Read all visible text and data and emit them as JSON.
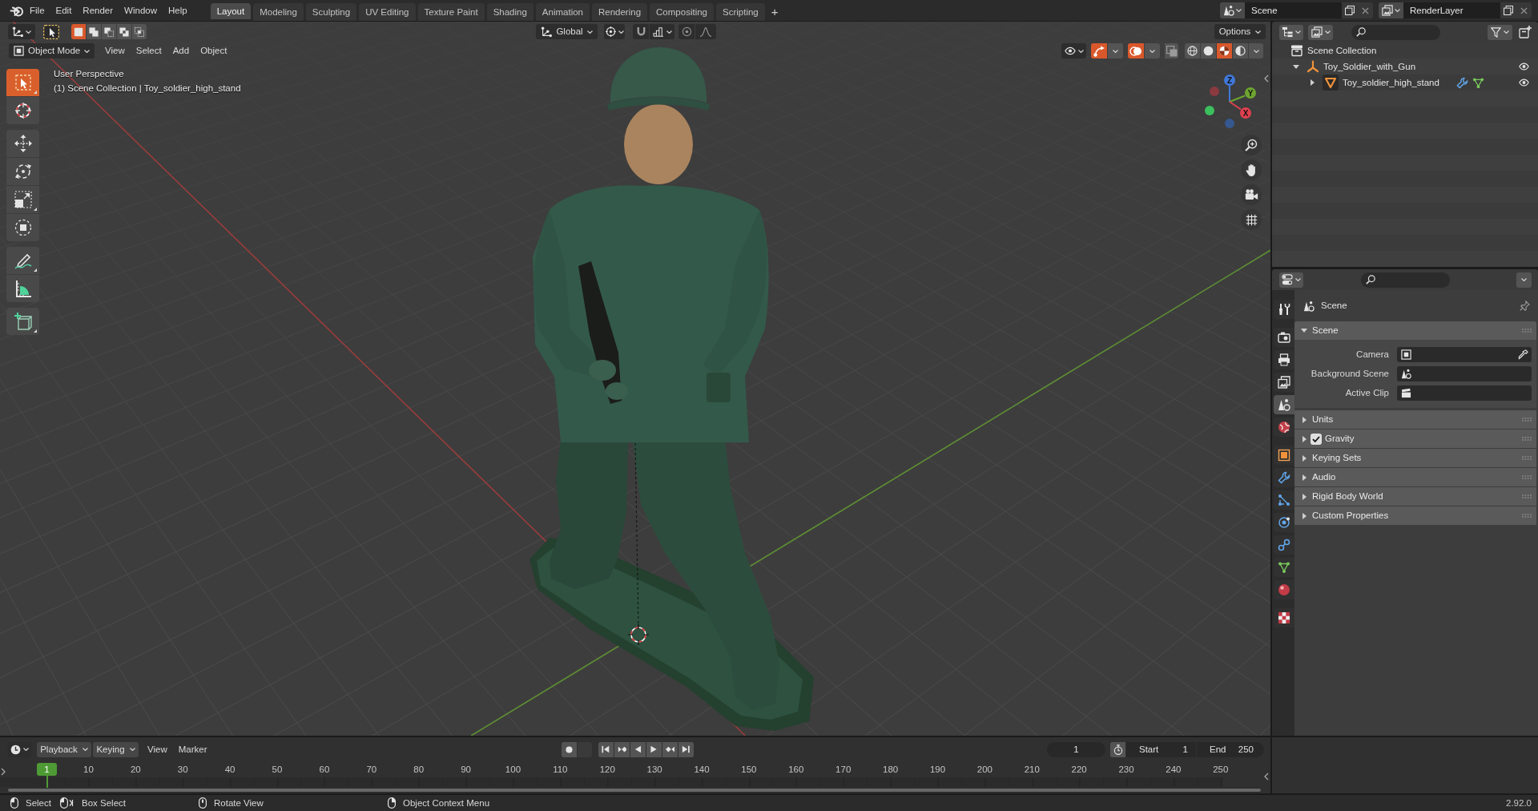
{
  "topbar": {
    "menus": [
      "File",
      "Edit",
      "Render",
      "Window",
      "Help"
    ],
    "workspaces": [
      {
        "label": "Layout",
        "selected": true
      },
      {
        "label": "Modeling",
        "selected": false
      },
      {
        "label": "Sculpting",
        "selected": false
      },
      {
        "label": "UV Editing",
        "selected": false
      },
      {
        "label": "Texture Paint",
        "selected": false
      },
      {
        "label": "Shading",
        "selected": false
      },
      {
        "label": "Animation",
        "selected": false
      },
      {
        "label": "Rendering",
        "selected": false
      },
      {
        "label": "Compositing",
        "selected": false
      },
      {
        "label": "Scripting",
        "selected": false
      }
    ],
    "add_workspace": "+",
    "scene": "Scene",
    "view_layer": "RenderLayer"
  },
  "viewport": {
    "editor_header": {
      "selection_modes": [
        {
          "kind": "set",
          "selected": true
        },
        {
          "kind": "extend",
          "selected": false
        },
        {
          "kind": "subtract",
          "selected": false
        },
        {
          "kind": "difference",
          "selected": false
        },
        {
          "kind": "intersect",
          "selected": false
        }
      ],
      "transform_orientation": "Global",
      "options": "Options"
    },
    "mode": "Object Mode",
    "menus": [
      "View",
      "Select",
      "Add",
      "Object"
    ],
    "toggles": [
      {
        "kind": "gizmos",
        "on": true
      },
      {
        "kind": "overlays",
        "on": true
      },
      {
        "kind": "xray",
        "on": false
      }
    ],
    "shading": [
      {
        "kind": "wireframe",
        "selected": false
      },
      {
        "kind": "solid",
        "selected": false
      },
      {
        "kind": "material",
        "selected": true
      },
      {
        "kind": "rendered",
        "selected": false
      }
    ],
    "tools": [
      [
        {
          "kind": "select_box",
          "selected": true
        },
        {
          "kind": "cursor",
          "selected": false
        }
      ],
      [
        {
          "kind": "move",
          "selected": false
        },
        {
          "kind": "rotate",
          "selected": false
        },
        {
          "kind": "scale",
          "selected": false
        },
        {
          "kind": "transform",
          "selected": false
        }
      ],
      [
        {
          "kind": "annotate",
          "selected": false
        },
        {
          "kind": "measure",
          "selected": false
        }
      ],
      [
        {
          "kind": "add_cube",
          "selected": false
        }
      ]
    ],
    "info": [
      "User Perspective",
      "(1) Scene Collection | Toy_soldier_high_stand"
    ],
    "gizmo_axes": [
      "Z",
      "Y",
      "X"
    ]
  },
  "outliner": {
    "root": {
      "label": "Scene Collection",
      "children": [
        {
          "label": "Toy_Soldier_with_Gun",
          "kind": "empty",
          "expanded": true,
          "visible": true,
          "children": [
            {
              "label": "Toy_soldier_high_stand",
              "kind": "mesh",
              "expanded": false,
              "visible": true,
              "data_icons": [
                {
                  "kind": "modifier"
                },
                {
                  "kind": "mesh_data"
                }
              ]
            }
          ]
        }
      ]
    }
  },
  "properties": {
    "tab_groups": [
      [
        {
          "kind": "tool",
          "selected": false
        }
      ],
      [
        {
          "kind": "render",
          "selected": false
        },
        {
          "kind": "output",
          "selected": false
        },
        {
          "kind": "view_layer",
          "selected": false
        },
        {
          "kind": "scene",
          "selected": true
        },
        {
          "kind": "world",
          "selected": false
        }
      ],
      [
        {
          "kind": "object",
          "selected": false
        },
        {
          "kind": "modifiers",
          "selected": false
        },
        {
          "kind": "particles",
          "selected": false
        },
        {
          "kind": "physics",
          "selected": false
        },
        {
          "kind": "constraints",
          "selected": false
        },
        {
          "kind": "data",
          "selected": false
        },
        {
          "kind": "material",
          "selected": false
        }
      ],
      [
        {
          "kind": "texture",
          "selected": false
        }
      ]
    ],
    "context": "Scene",
    "panels": [
      {
        "title": "Scene",
        "expanded": true,
        "fields": [
          {
            "label": "Camera",
            "kind": "object"
          },
          {
            "label": "Background Scene",
            "kind": "scene"
          },
          {
            "label": "Active Clip",
            "kind": "clip"
          }
        ]
      },
      {
        "title": "Units",
        "expanded": false
      },
      {
        "title": "Gravity",
        "expanded": false,
        "checked": true
      },
      {
        "title": "Keying Sets",
        "expanded": false
      },
      {
        "title": "Audio",
        "expanded": false
      },
      {
        "title": "Rigid Body World",
        "expanded": false
      },
      {
        "title": "Custom Properties",
        "expanded": false
      }
    ]
  },
  "timeline": {
    "playback": "Playback",
    "keying": "Keying",
    "menus": [
      "View",
      "Marker"
    ],
    "current_frame": "1",
    "start_label": "Start",
    "start": "1",
    "end_label": "End",
    "end": "250",
    "playhead": "1",
    "frame_labels": [
      "10",
      "20",
      "30",
      "40",
      "50",
      "60",
      "70",
      "80",
      "90",
      "100",
      "110",
      "120",
      "130",
      "140",
      "150",
      "160",
      "170",
      "180",
      "190",
      "200",
      "210",
      "220",
      "230",
      "240",
      "250"
    ]
  },
  "status_bar": {
    "hints": [
      {
        "kind": "mouse_left",
        "label": "Select"
      },
      {
        "kind": "mouse_drag",
        "label": "Box Select"
      },
      {
        "kind": "mouse_middle",
        "label": "Rotate View"
      },
      {
        "kind": "mouse_right",
        "label": "Object Context Menu"
      }
    ],
    "version": "2.92.0"
  }
}
